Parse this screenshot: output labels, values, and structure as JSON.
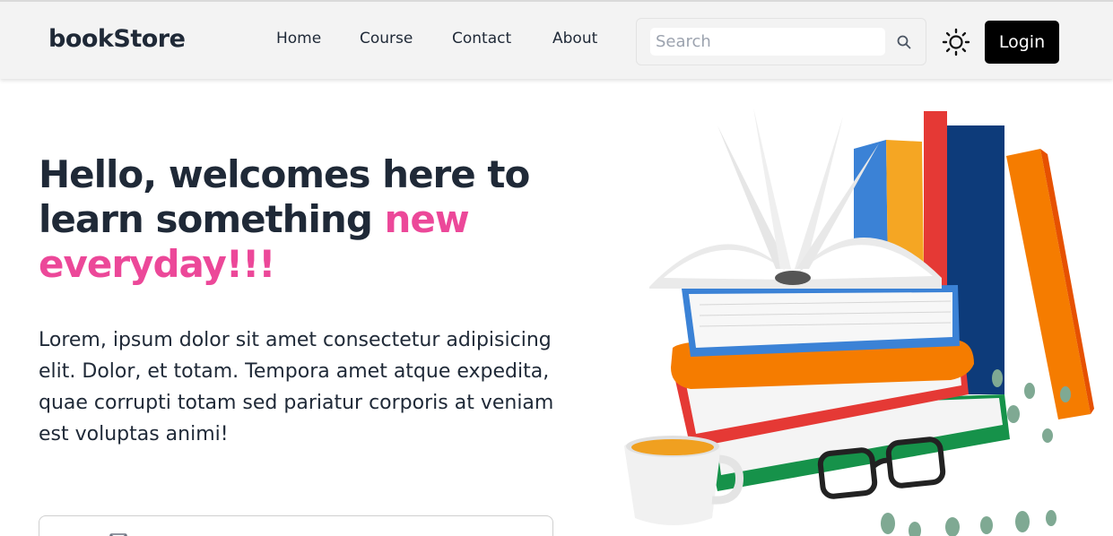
{
  "navbar": {
    "logo": "bookStore",
    "links": [
      "Home",
      "Course",
      "Contact",
      "About"
    ],
    "search_placeholder": "Search",
    "search_icon": "search-icon",
    "theme_icon": "sun-icon",
    "login_label": "Login"
  },
  "hero": {
    "title_part1": "Hello, welcomes here to learn something ",
    "title_accent": "new everyday!!!",
    "description": "Lorem, ipsum dolor sit amet consectetur adipisicing elit. Dolor, et totam. Tempora amet atque expedita, quae corrupti totam sed pariatur corporis at veniam est voluptas animi!",
    "email_icon": "mail-icon",
    "illustration": "books-stack-illustration"
  },
  "colors": {
    "accent": "#ec4899",
    "navbar_bg": "#f3f3f3",
    "button_bg": "#000000"
  }
}
